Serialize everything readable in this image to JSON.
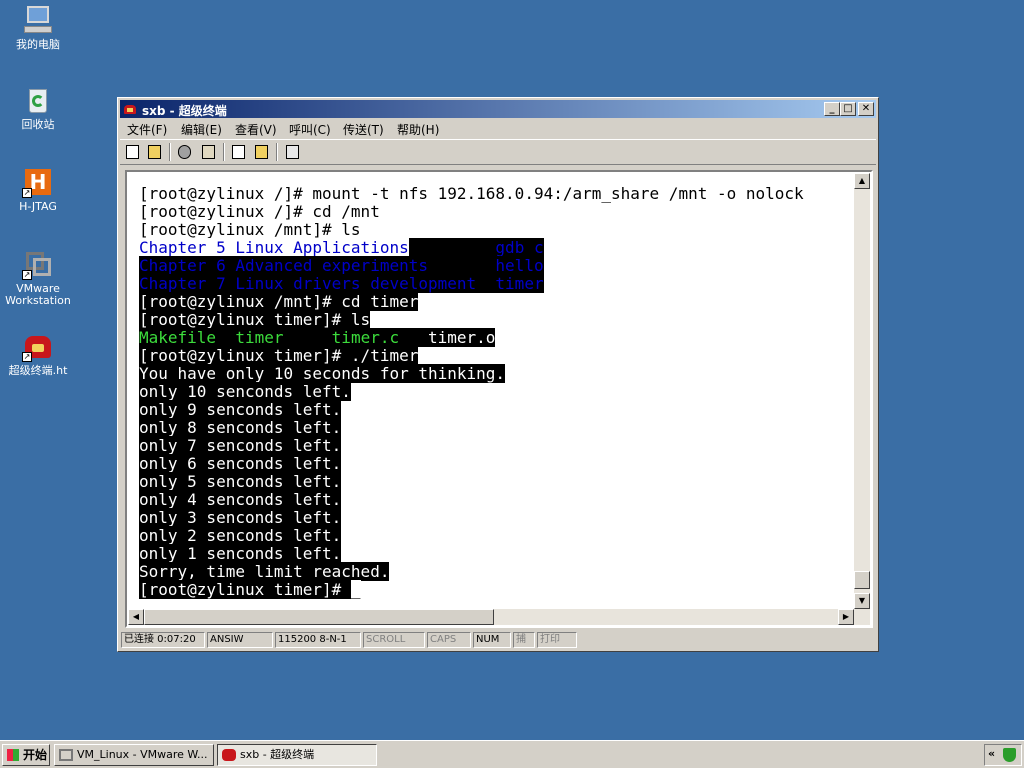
{
  "desktop": {
    "icons": [
      {
        "label": "我的电脑",
        "icon": "my-computer-icon"
      },
      {
        "label": "回收站",
        "icon": "recycle-bin-icon"
      },
      {
        "label": "H-JTAG",
        "icon": "hjtag-icon"
      },
      {
        "label": "VMware Workstation",
        "icon": "vmware-icon"
      },
      {
        "label": "超级终端.ht",
        "icon": "hyperterminal-icon"
      }
    ]
  },
  "window": {
    "title": "sxb - 超级终端",
    "controls": {
      "minimize": "_",
      "maximize": "□",
      "close": "✕"
    },
    "menu": [
      "文件(F)",
      "编辑(E)",
      "查看(V)",
      "呼叫(C)",
      "传送(T)",
      "帮助(H)"
    ],
    "toolbar": [
      "new-icon",
      "open-icon",
      "disconnect-icon",
      "connect-icon",
      "send-icon",
      "receive-icon",
      "properties-icon"
    ],
    "status": {
      "connected": "已连接 0:07:20",
      "emulation": "ANSIW",
      "port": "115200 8-N-1",
      "scroll": "SCROLL",
      "caps": "CAPS",
      "num": "NUM",
      "capture": "捕",
      "print": "打印"
    }
  },
  "terminal": {
    "colors": {
      "fg": "#000000",
      "bg": "#ffffff",
      "inv_bg": "#000000",
      "inv_fg": "#ffffff",
      "dir": "#0000c8",
      "exec": "#3cdc3c"
    },
    "lines": [
      [
        {
          "text": "[root@zylinux /]# mount -t nfs 192.168.0.94:/arm_share /mnt -o nolock",
          "style": "plain"
        }
      ],
      [
        {
          "text": "[root@zylinux /]# cd /mnt",
          "style": "plain"
        }
      ],
      [
        {
          "text": "[root@zylinux /mnt]# ls",
          "style": "plain"
        }
      ],
      [
        {
          "text": "Chapter_5_Linux_Applications",
          "style": "dir"
        },
        {
          "text": "         ",
          "style": "inv"
        },
        {
          "text": "gdb_c",
          "style": "dir-inv"
        }
      ],
      [
        {
          "text": "Chapter_6_Advanced_experiments       hello",
          "style": "dir-inv"
        }
      ],
      [
        {
          "text": "Chapter_7_Linux_drivers_development  timer",
          "style": "dir-inv"
        }
      ],
      [
        {
          "text": "[root@zylinux /mnt]# cd timer",
          "style": "inv"
        }
      ],
      [
        {
          "text": "[root@zylinux timer]# ls",
          "style": "inv"
        }
      ],
      [
        {
          "text": "Makefile  timer",
          "style": "exec-inv"
        },
        {
          "text": "     ",
          "style": "inv"
        },
        {
          "text": "timer.c",
          "style": "exec-inv"
        },
        {
          "text": "   timer.o",
          "style": "inv"
        }
      ],
      [
        {
          "text": "[root@zylinux timer]# ./timer",
          "style": "inv"
        }
      ],
      [
        {
          "text": "You have only 10 seconds for thinking.",
          "style": "inv"
        }
      ],
      [
        {
          "text": "only 10 senconds left.",
          "style": "inv"
        }
      ],
      [
        {
          "text": "only 9 senconds left.",
          "style": "inv"
        }
      ],
      [
        {
          "text": "only 8 senconds left.",
          "style": "inv"
        }
      ],
      [
        {
          "text": "only 7 senconds left.",
          "style": "inv"
        }
      ],
      [
        {
          "text": "only 6 senconds left.",
          "style": "inv"
        }
      ],
      [
        {
          "text": "only 5 senconds left.",
          "style": "inv"
        }
      ],
      [
        {
          "text": "only 4 senconds left.",
          "style": "inv"
        }
      ],
      [
        {
          "text": "only 3 senconds left.",
          "style": "inv"
        }
      ],
      [
        {
          "text": "only 2 senconds left.",
          "style": "inv"
        }
      ],
      [
        {
          "text": "only 1 senconds left.",
          "style": "inv"
        }
      ],
      [
        {
          "text": "Sorry, time limit reached.",
          "style": "inv"
        }
      ],
      [
        {
          "text": "[root@zylinux timer]# ",
          "style": "inv"
        },
        {
          "text": "_",
          "style": "plain"
        }
      ]
    ]
  },
  "taskbar": {
    "start": "开始",
    "tasks": [
      {
        "label": "VM_Linux - VMware W...",
        "icon": "vmware-icon",
        "active": false
      },
      {
        "label": "sxb - 超级终端",
        "icon": "hyperterminal-icon",
        "active": true
      }
    ],
    "tray": [
      "collapse-arrows-icon",
      "security-shield-icon"
    ]
  }
}
